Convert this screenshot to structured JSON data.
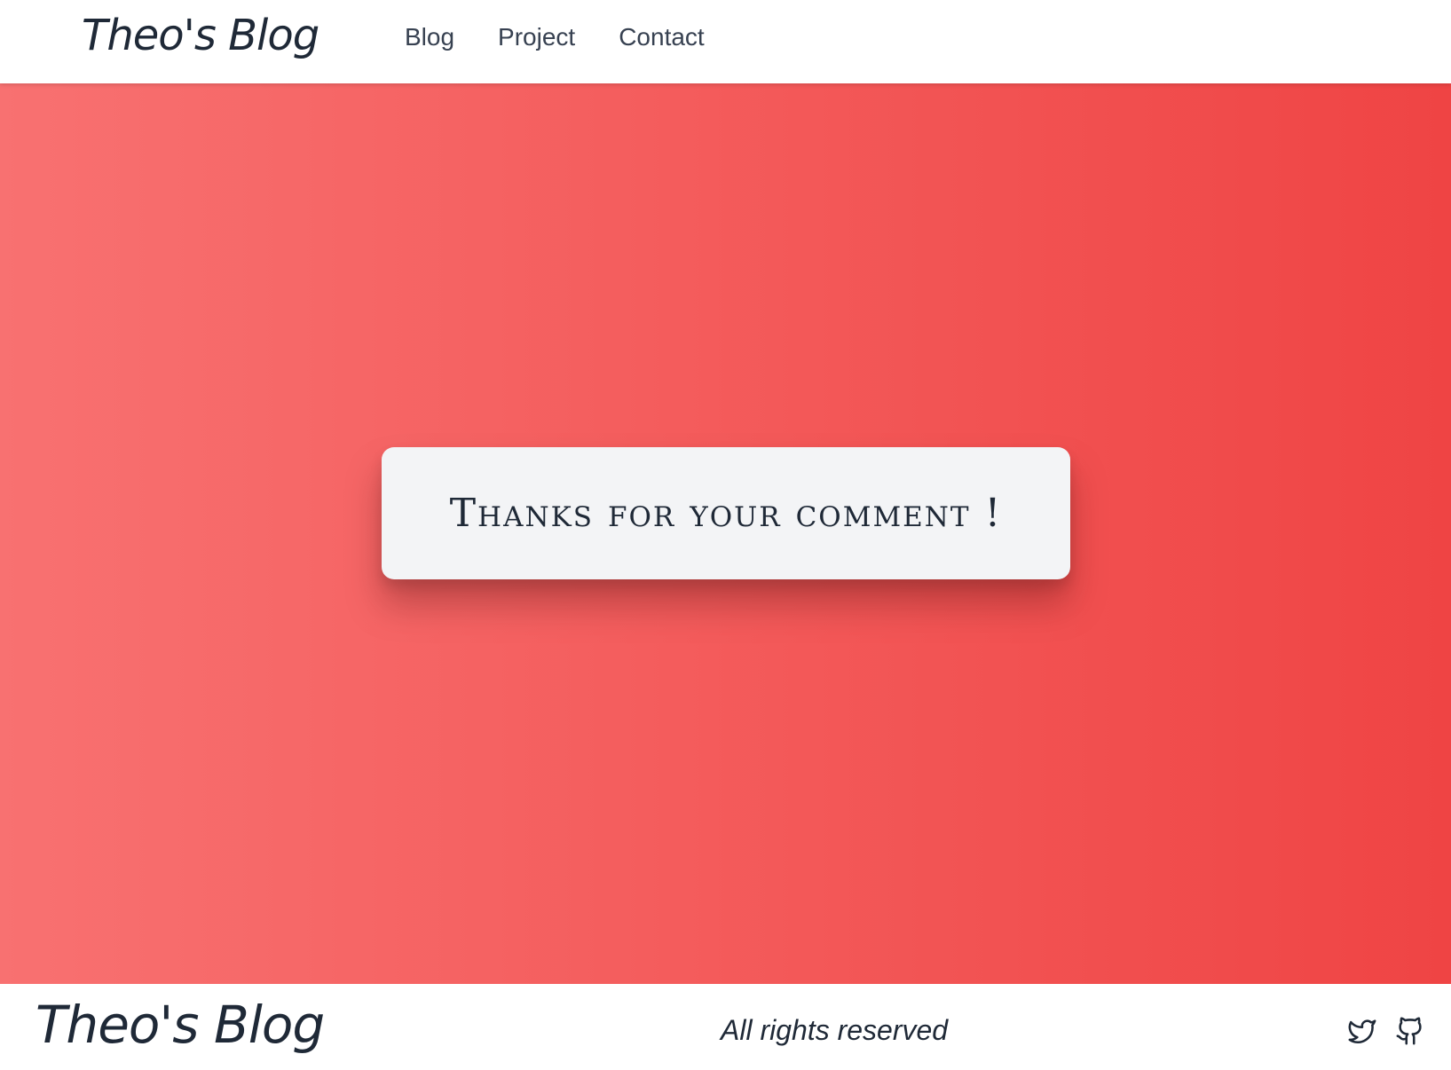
{
  "header": {
    "brand": "Theo's Blog",
    "nav": [
      {
        "label": "Blog"
      },
      {
        "label": "Project"
      },
      {
        "label": "Contact"
      }
    ]
  },
  "hero": {
    "gradient_start": "#f87171",
    "gradient_end": "#ef4444",
    "message": "Thanks for your comment !"
  },
  "footer": {
    "brand": "Theo's Blog",
    "text": "All rights reserved",
    "social_icons": [
      "twitter-icon",
      "github-icon"
    ]
  }
}
